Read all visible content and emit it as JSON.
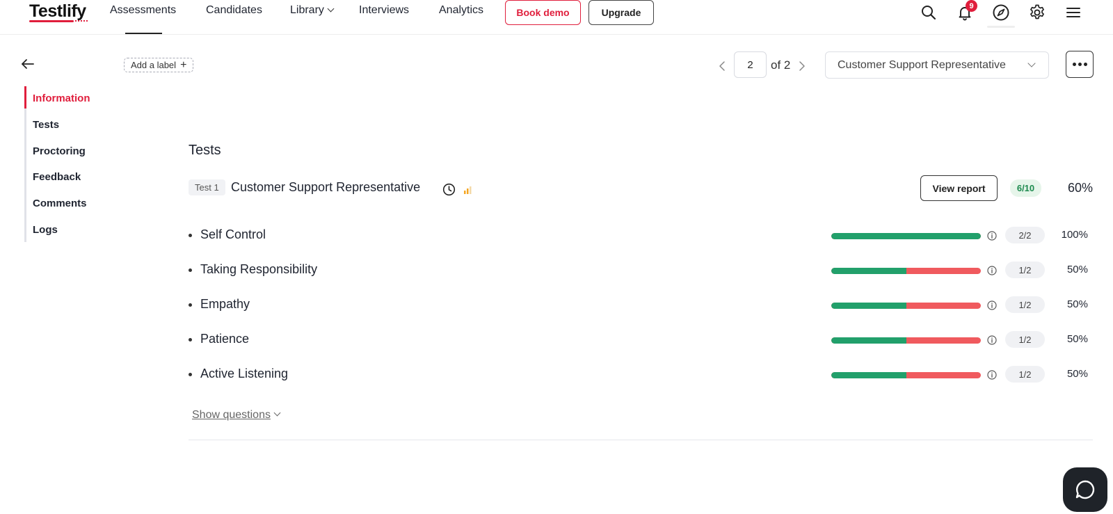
{
  "app": {
    "logo": "Testlify"
  },
  "nav": {
    "items": [
      {
        "label": "Assessments"
      },
      {
        "label": "Candidates"
      },
      {
        "label": "Library"
      },
      {
        "label": "Interviews"
      },
      {
        "label": "Analytics"
      }
    ],
    "book_demo": "Book demo",
    "upgrade": "Upgrade",
    "notification_count": "9"
  },
  "subheader": {
    "add_label": "Add a label",
    "pager_value": "2",
    "pager_of": "of 2",
    "assessment_selected": "Customer Support Representative"
  },
  "sidebar": {
    "items": [
      {
        "label": "Information"
      },
      {
        "label": "Tests"
      },
      {
        "label": "Proctoring"
      },
      {
        "label": "Feedback"
      },
      {
        "label": "Comments"
      },
      {
        "label": "Logs"
      }
    ]
  },
  "tests": {
    "title": "Tests",
    "test": {
      "tag": "Test 1",
      "name": "Customer Support Representative",
      "view_report": "View report",
      "score": "6/10",
      "percent": "60%"
    },
    "skills": [
      {
        "name": "Self Control",
        "fraction": "2/2",
        "percent": "100%",
        "ratio": 1.0
      },
      {
        "name": "Taking Responsibility",
        "fraction": "1/2",
        "percent": "50%",
        "ratio": 0.5
      },
      {
        "name": "Empathy",
        "fraction": "1/2",
        "percent": "50%",
        "ratio": 0.5
      },
      {
        "name": "Patience",
        "fraction": "1/2",
        "percent": "50%",
        "ratio": 0.5
      },
      {
        "name": "Active Listening",
        "fraction": "1/2",
        "percent": "50%",
        "ratio": 0.5
      }
    ],
    "show_questions": "Show questions"
  },
  "colors": {
    "brand": "#e01e3c",
    "bar_pass": "#22a06b",
    "bar_fail": "#f05a5e"
  }
}
